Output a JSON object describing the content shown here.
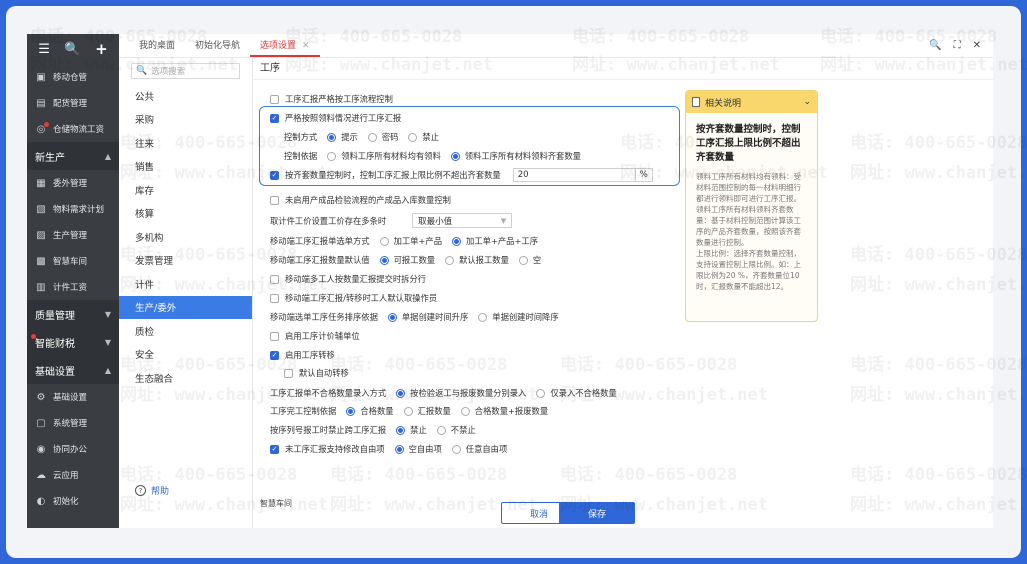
{
  "watermark": {
    "phone": "电话: 400-665-0028",
    "site": "网址: www.chanjet.net"
  },
  "nav": {
    "top_icons": [
      "menu-icon",
      "search-icon",
      "plus-icon"
    ],
    "items_a": [
      {
        "label": "移动仓管",
        "icon": "box-icon"
      },
      {
        "label": "配货管理",
        "icon": "truck-icon"
      },
      {
        "label": "仓储物流工资",
        "icon": "coin-icon"
      }
    ],
    "group_production": "新生产",
    "items_b": [
      {
        "label": "委外管理",
        "icon": "outsource-icon"
      },
      {
        "label": "物料需求计划",
        "icon": "plan-icon"
      },
      {
        "label": "生产管理",
        "icon": "factory-icon"
      },
      {
        "label": "智慧车间",
        "icon": "workshop-icon"
      },
      {
        "label": "计件工资",
        "icon": "wage-icon"
      }
    ],
    "group_quality": "质量管理",
    "group_finance": "智能财税",
    "group_basic": "基础设置",
    "items_c": [
      {
        "label": "基础设置",
        "icon": "settings-icon"
      },
      {
        "label": "系统管理",
        "icon": "system-icon"
      },
      {
        "label": "协同办公",
        "icon": "collab-icon"
      },
      {
        "label": "云应用",
        "icon": "cloud-icon"
      },
      {
        "label": "初始化",
        "icon": "init-icon"
      }
    ]
  },
  "tabs": [
    {
      "label": "我的桌面"
    },
    {
      "label": "初始化导航"
    },
    {
      "label": "选项设置"
    }
  ],
  "window_controls": [
    "search-icon",
    "fullscreen-icon",
    "close-icon"
  ],
  "categories": {
    "search_placeholder": "选项搜索",
    "items": [
      "公共",
      "采购",
      "往来",
      "销售",
      "库存",
      "核算",
      "多机构",
      "发票管理",
      "计件",
      "生产/委外",
      "质检",
      "安全",
      "生态融合"
    ],
    "active_index": 9,
    "help": "帮助"
  },
  "section_title": "工序",
  "settings": {
    "r1": "工序汇报严格按工序流程控制",
    "r2": "严格按照领料情况进行工序汇报",
    "r3_label": "控制方式",
    "r3_opts": [
      "提示",
      "密码",
      "禁止"
    ],
    "r4_label": "控制依据",
    "r4_opts": [
      "领料工序所有材料均有领料",
      "领料工序所有材料领料齐套数量"
    ],
    "r5_label": "按齐套数量控制时，控制工序汇报上限比例不超出齐套数量",
    "r5_value": "20",
    "r5_unit": "%",
    "r6": "未启用产成品检验流程的产成品入库数量控制",
    "r7_label": "取计件工价设置工价存在多条时",
    "r7_value": "取最小值",
    "r8_label": "移动端工序汇报单选单方式",
    "r8_opts": [
      "加工单+产品",
      "加工单+产品+工序"
    ],
    "r9_label": "移动端工序汇报数量默认值",
    "r9_opts": [
      "可报工数量",
      "默认报工数量",
      "空"
    ],
    "r10": "移动端多工人按数量汇报提交时拆分行",
    "r11": "移动端工序汇报/转移时工人默认取操作员",
    "r12_label": "移动端选单工序任务排序依据",
    "r12_opts": [
      "单据创建时间升序",
      "单据创建时间降序"
    ],
    "r13": "启用工序计价辅单位",
    "r14": "启用工序转移",
    "r15": "默认自动转移",
    "r16_label": "工序汇报单不合格数量录入方式",
    "r16_opts": [
      "按检验返工与报废数量分别录入",
      "仅录入不合格数量"
    ],
    "r17_label": "工序完工控制依据",
    "r17_opts": [
      "合格数量",
      "汇报数量",
      "合格数量+报废数量"
    ],
    "r18_label": "按序列号报工时禁止跨工序汇报",
    "r18_opts": [
      "禁止",
      "不禁止"
    ],
    "r19": "末工序汇报支持修改自由项",
    "r19_opts": [
      "空自由项",
      "任意自由项"
    ],
    "cutoff": "智慧车间"
  },
  "info": {
    "header": "相关说明",
    "title": "按齐套数量控制时，控制工序汇报上限比例不超出齐套数量",
    "body": "领料工序所有材料均有领料：受材料范围控制的每一材料明细行都进行领料即可进行工序汇报。\n领料工序所有材料领料齐套数量：基于材料控制范围计算该工序的产品齐套数量，按照该齐套数量进行控制。\n上限比例：选择齐套数量控制，支持设置控制上限比例。如：上限比例为20 %，齐套数量位10时，汇报数量不能超出12。"
  },
  "footer": {
    "cancel": "取消",
    "save": "保存"
  }
}
